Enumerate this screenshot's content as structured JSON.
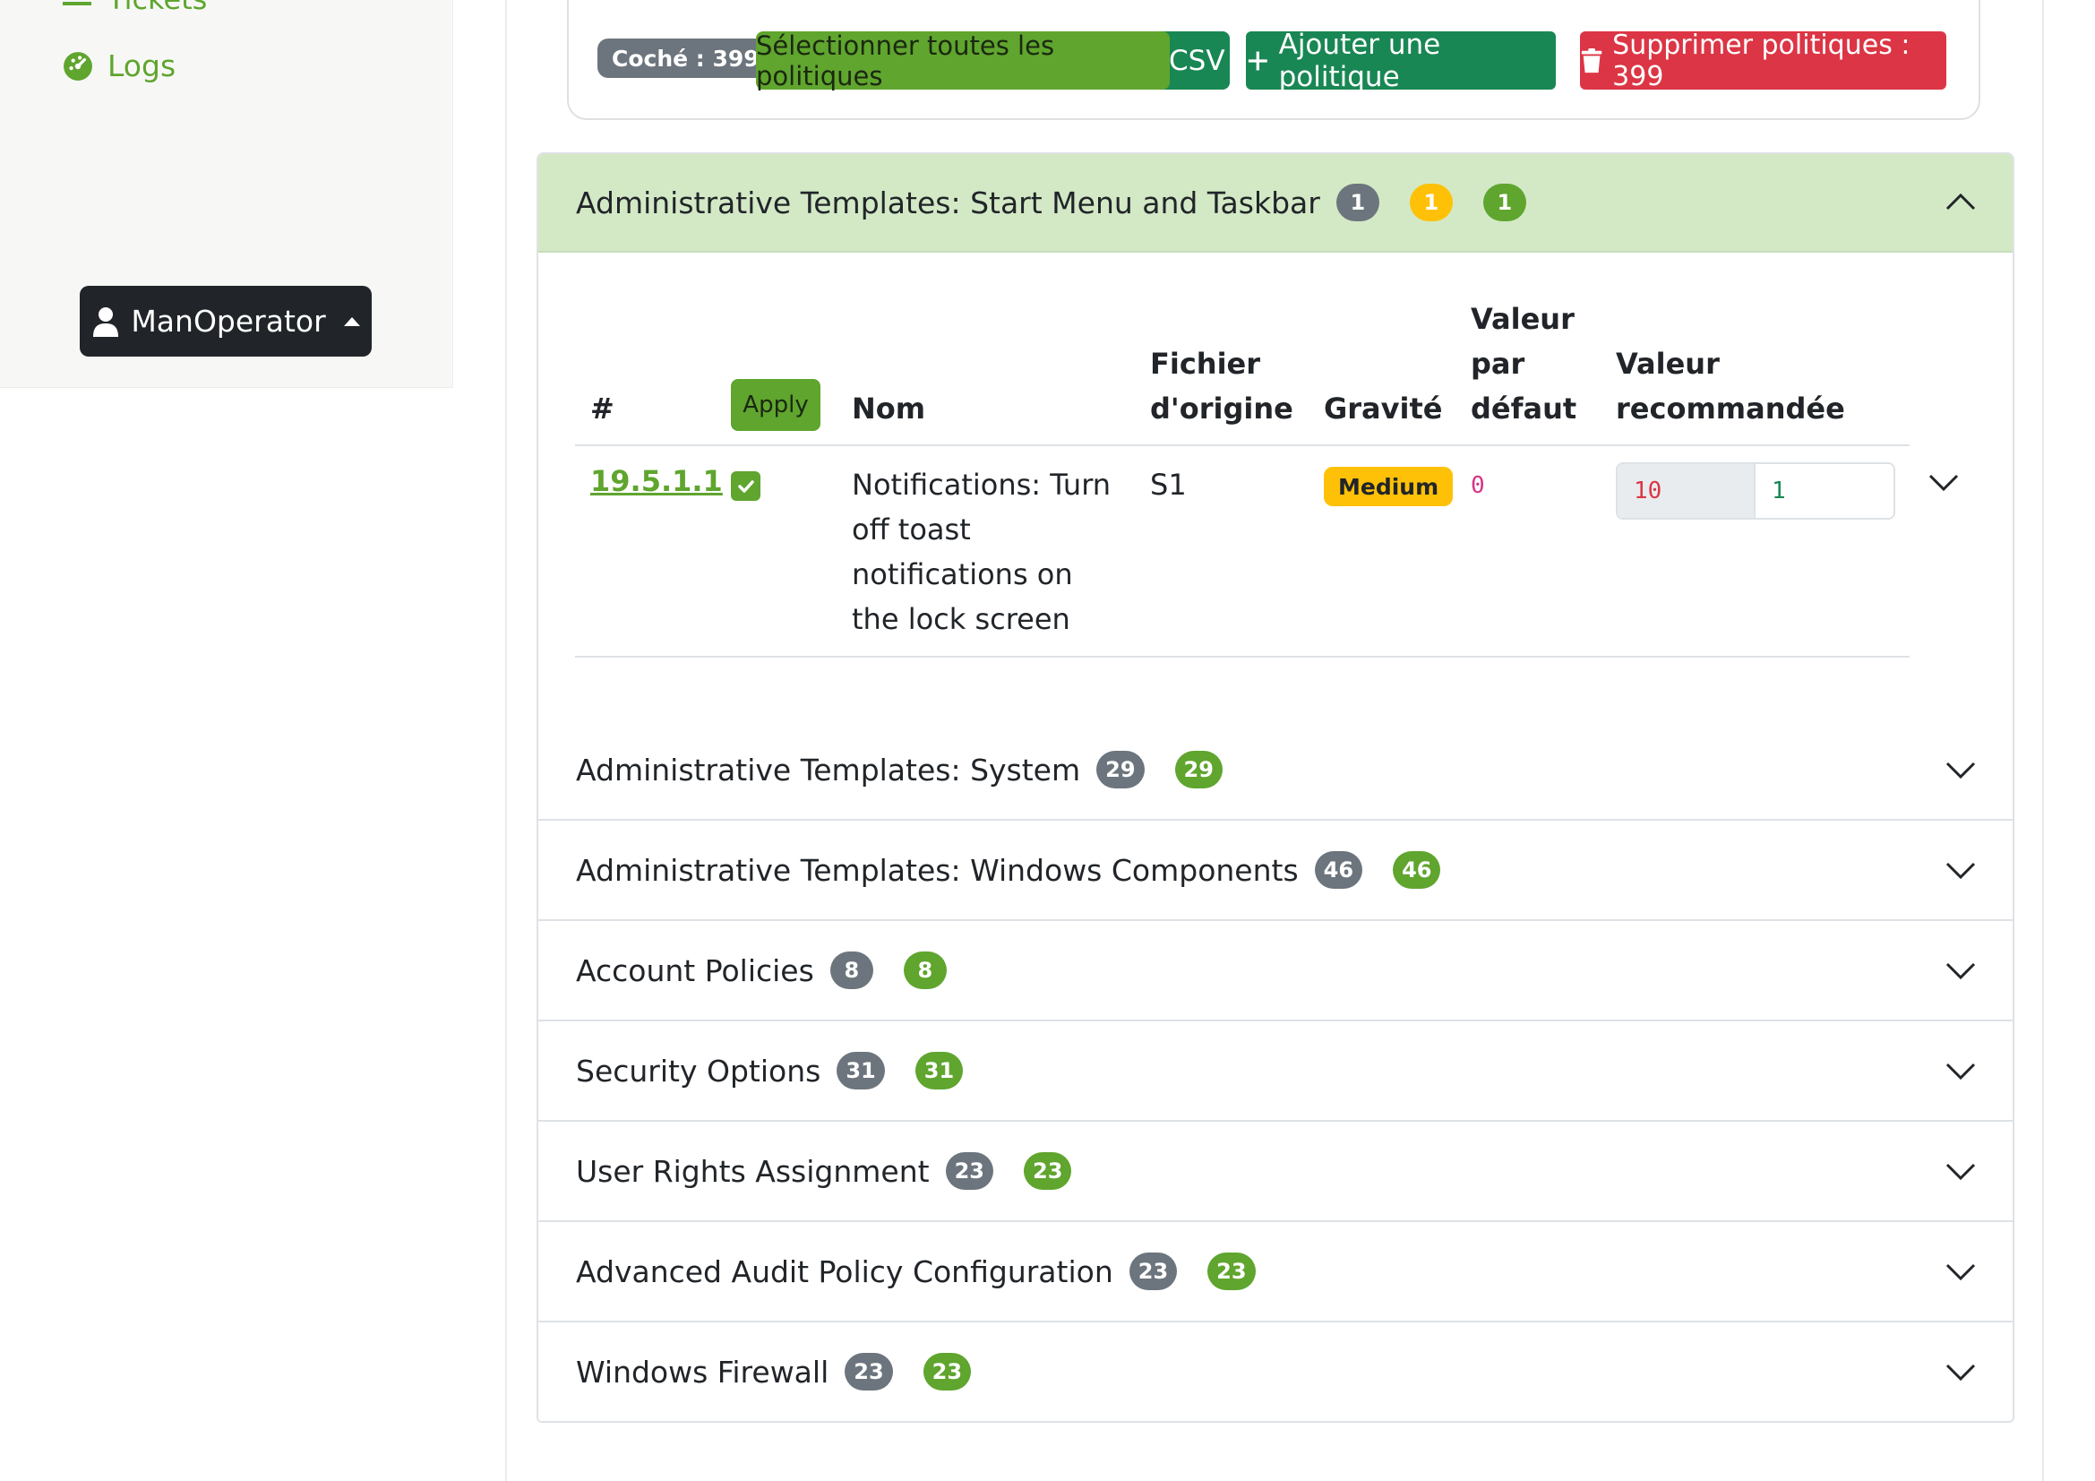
{
  "sidebar": {
    "tickets_label": "Tickets",
    "logs_label": "Logs",
    "user_label": "ManOperator"
  },
  "toolbar": {
    "checked_label": "Coché : 399",
    "select_all_label": "Sélectionner toutes les politiques",
    "csv_label": "CSV",
    "add_label": "Ajouter une politique",
    "delete_label": "Supprimer politiques : 399"
  },
  "open_section": {
    "title": "Administrative Templates: Start Menu and Taskbar",
    "badges": [
      "1",
      "1",
      "1"
    ],
    "table": {
      "headers": {
        "index": "#",
        "apply": "Apply",
        "name": "Nom",
        "file": "Fichier d'origine",
        "severity": "Gravité",
        "default": "Valeur par défaut",
        "recommended": "Valeur recommandée"
      },
      "rows": [
        {
          "id": "19.5.1.1",
          "checked": true,
          "name": "Notifications: Turn off toast notifications on the lock screen",
          "file": "S1",
          "severity": "Medium",
          "default": "0",
          "recommended_current": "10",
          "recommended_new": "1"
        }
      ]
    }
  },
  "sections": [
    {
      "title": "Administrative Templates: System",
      "total": "29",
      "ok": "29"
    },
    {
      "title": "Administrative Templates: Windows Components",
      "total": "46",
      "ok": "46"
    },
    {
      "title": "Account Policies",
      "total": "8",
      "ok": "8"
    },
    {
      "title": "Security Options",
      "total": "31",
      "ok": "31"
    },
    {
      "title": "User Rights Assignment",
      "total": "23",
      "ok": "23"
    },
    {
      "title": "Advanced Audit Policy Configuration",
      "total": "23",
      "ok": "23"
    },
    {
      "title": "Windows Firewall",
      "total": "23",
      "ok": "23"
    }
  ],
  "colors": {
    "brand_green": "#5fa52e",
    "success": "#198754",
    "danger": "#dc3545",
    "warning": "#ffc107",
    "secondary": "#6c757d",
    "open_header_bg": "#d3e9c6"
  },
  "icons": {
    "logs": "dashboard-gauge-icon",
    "user": "user-icon",
    "add": "plus-icon",
    "delete": "trash-icon",
    "collapse": "chevron-up-icon",
    "expand": "chevron-down-icon"
  }
}
